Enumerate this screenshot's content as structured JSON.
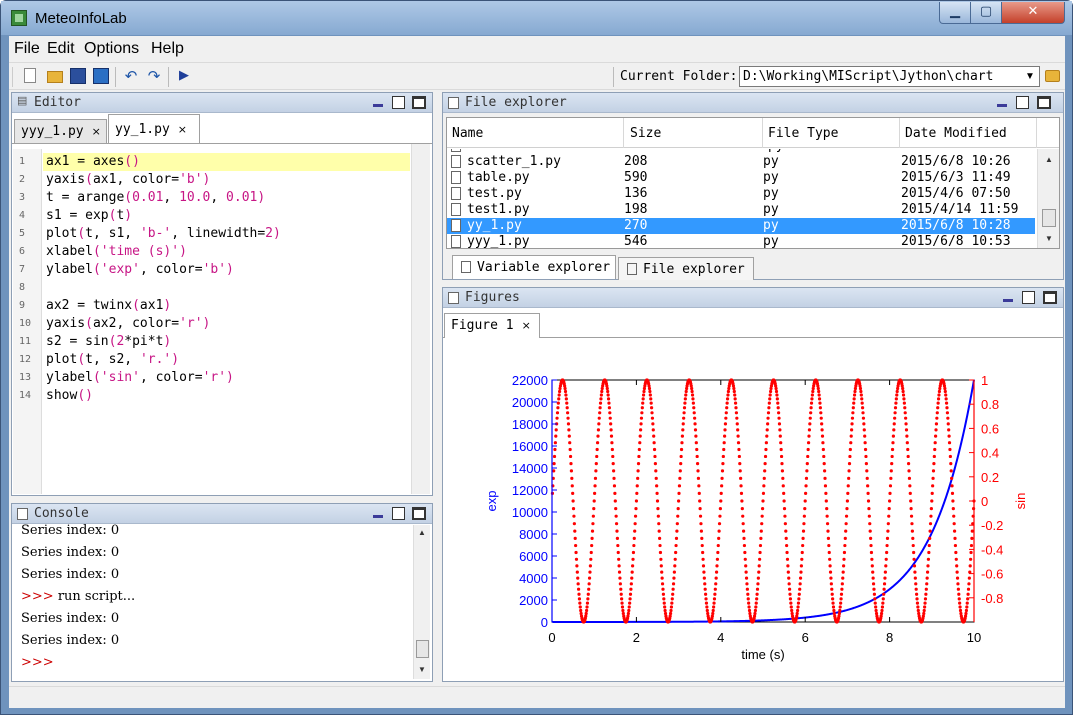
{
  "window": {
    "title": "MeteoInfoLab"
  },
  "menu": [
    "File",
    "Edit",
    "Options",
    "Help"
  ],
  "toolbar": {
    "current_folder_label": "Current Folder:",
    "current_folder": "D:\\Working\\MIScript\\Jython\\chart"
  },
  "editor": {
    "title": "Editor",
    "tabs": [
      {
        "label": "yyy_1.py",
        "active": false
      },
      {
        "label": "yy_1.py",
        "active": true
      }
    ],
    "line_numbers": [
      "1",
      "2",
      "3",
      "4",
      "5",
      "6",
      "7",
      "8",
      "9",
      "10",
      "11",
      "12",
      "13",
      "14"
    ],
    "lines": [
      "ax1 = axes()",
      "yaxis(ax1, color='b')",
      "t = arange(0.01, 10.0, 0.01)",
      "s1 = exp(t)",
      "plot(t, s1, 'b-', linewidth=2)",
      "xlabel('time (s)')",
      "ylabel('exp', color='b')",
      "",
      "ax2 = twinx(ax1)",
      "yaxis(ax2, color='r')",
      "s2 = sin(2*pi*t)",
      "plot(t, s2, 'r.')",
      "ylabel('sin', color='r')",
      "show()"
    ]
  },
  "console": {
    "title": "Console",
    "lines": [
      "Series index: 0",
      "Series index: 0",
      "Series index: 0",
      ">>> run script...",
      "Series index: 0",
      "Series index: 0",
      ">>>"
    ]
  },
  "file_explorer": {
    "title": "File explorer",
    "columns": [
      "Name",
      "Size",
      "File Type",
      "Date Modified"
    ],
    "partial_row_type": "py",
    "rows": [
      {
        "name": "scatter_1.py",
        "size": "208",
        "type": "py",
        "date": "2015/6/8 10:26",
        "selected": false
      },
      {
        "name": "table.py",
        "size": "590",
        "type": "py",
        "date": "2015/6/3 11:49",
        "selected": false
      },
      {
        "name": "test.py",
        "size": "136",
        "type": "py",
        "date": "2015/4/6 07:50",
        "selected": false
      },
      {
        "name": "test1.py",
        "size": "198",
        "type": "py",
        "date": "2015/4/14 11:59",
        "selected": false
      },
      {
        "name": "yy_1.py",
        "size": "270",
        "type": "py",
        "date": "2015/6/8 10:28",
        "selected": true
      },
      {
        "name": "yyy_1.py",
        "size": "546",
        "type": "py",
        "date": "2015/6/8 10:53",
        "selected": false
      }
    ],
    "bottom_tabs": [
      "Variable explorer",
      "File explorer"
    ]
  },
  "figures": {
    "title": "Figures",
    "tab": "Figure 1"
  },
  "chart_data": {
    "type": "line",
    "xlabel": "time (s)",
    "x_ticks": [
      "0",
      "2",
      "4",
      "6",
      "8",
      "10"
    ],
    "xlim": [
      0,
      10
    ],
    "left_axis": {
      "label": "exp",
      "color": "#0000ff",
      "ylim": [
        0,
        22000
      ],
      "ticks": [
        "0",
        "2000",
        "4000",
        "6000",
        "8000",
        "10000",
        "12000",
        "14000",
        "16000",
        "18000",
        "20000",
        "22000"
      ]
    },
    "right_axis": {
      "label": "sin",
      "color": "#ff0000",
      "ylim": [
        -1,
        1
      ],
      "ticks": [
        "1",
        "0.8",
        "0.6",
        "0.4",
        "0.2",
        "0",
        "-0.2",
        "-0.4",
        "-0.6",
        "-0.8"
      ]
    },
    "series": [
      {
        "function": "exp(t)",
        "t_range": [
          0.01,
          10.0,
          0.01
        ],
        "axis": "left",
        "style": "solid-line",
        "color": "#0000ff",
        "linewidth": 2
      },
      {
        "function": "sin(2*pi*t)",
        "t_range": [
          0.01,
          10.0,
          0.01
        ],
        "axis": "right",
        "style": "dots",
        "color": "#ff0000"
      }
    ]
  }
}
